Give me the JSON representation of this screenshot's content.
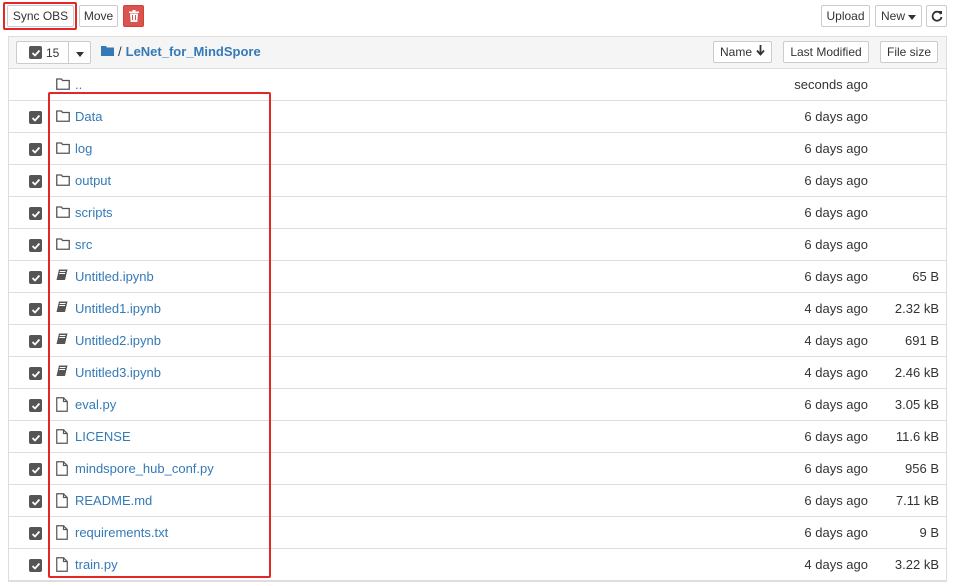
{
  "toolbar": {
    "sync_label": "Sync OBS",
    "move_label": "Move",
    "delete_icon": "trash-icon",
    "upload_label": "Upload",
    "new_label": "New",
    "refresh_icon": "refresh-icon"
  },
  "list_header": {
    "selected_count": "15",
    "breadcrumb_separator": "/",
    "current_dir": "LeNet_for_MindSpore",
    "sort_name_label": "Name",
    "sort_modified_label": "Last Modified",
    "sort_size_label": "File size"
  },
  "parent_row": {
    "name": "..",
    "modified": "seconds ago"
  },
  "rows": [
    {
      "name": "Data",
      "type": "folder",
      "modified": "6 days ago",
      "size": ""
    },
    {
      "name": "log",
      "type": "folder",
      "modified": "6 days ago",
      "size": ""
    },
    {
      "name": "output",
      "type": "folder",
      "modified": "6 days ago",
      "size": ""
    },
    {
      "name": "scripts",
      "type": "folder",
      "modified": "6 days ago",
      "size": ""
    },
    {
      "name": "src",
      "type": "folder",
      "modified": "6 days ago",
      "size": ""
    },
    {
      "name": "Untitled.ipynb",
      "type": "notebook",
      "modified": "6 days ago",
      "size": "65 B"
    },
    {
      "name": "Untitled1.ipynb",
      "type": "notebook",
      "modified": "4 days ago",
      "size": "2.32 kB"
    },
    {
      "name": "Untitled2.ipynb",
      "type": "notebook",
      "modified": "4 days ago",
      "size": "691 B"
    },
    {
      "name": "Untitled3.ipynb",
      "type": "notebook",
      "modified": "4 days ago",
      "size": "2.46 kB"
    },
    {
      "name": "eval.py",
      "type": "file",
      "modified": "6 days ago",
      "size": "3.05 kB"
    },
    {
      "name": "LICENSE",
      "type": "file",
      "modified": "6 days ago",
      "size": "11.6 kB"
    },
    {
      "name": "mindspore_hub_conf.py",
      "type": "file",
      "modified": "6 days ago",
      "size": "956 B"
    },
    {
      "name": "README.md",
      "type": "file",
      "modified": "6 days ago",
      "size": "7.11 kB"
    },
    {
      "name": "requirements.txt",
      "type": "file",
      "modified": "6 days ago",
      "size": "9 B"
    },
    {
      "name": "train.py",
      "type": "file",
      "modified": "4 days ago",
      "size": "3.22 kB"
    }
  ],
  "colors": {
    "link": "#337ab7",
    "highlight": "#e0282b",
    "danger": "#d9534f"
  }
}
